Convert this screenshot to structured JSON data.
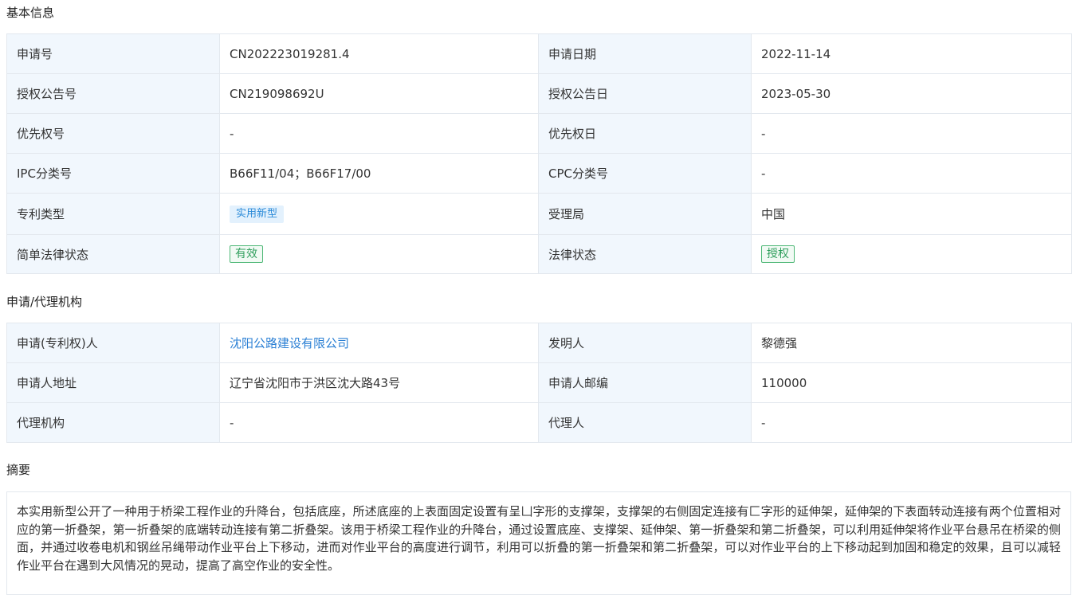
{
  "basic_info": {
    "title": "基本信息",
    "rows": [
      {
        "label1": "申请号",
        "value1": "CN202223019281.4",
        "label2": "申请日期",
        "value2": "2022-11-14"
      },
      {
        "label1": "授权公告号",
        "value1": "CN219098692U",
        "label2": "授权公告日",
        "value2": "2023-05-30"
      },
      {
        "label1": "优先权号",
        "value1": "-",
        "label2": "优先权日",
        "value2": "-"
      },
      {
        "label1": "IPC分类号",
        "value1": "B66F11/04；B66F17/00",
        "label2": "CPC分类号",
        "value2": "-"
      },
      {
        "label1": "专利类型",
        "value1": "实用新型",
        "label2": "受理局",
        "value2": "中国"
      },
      {
        "label1": "简单法律状态",
        "value1": "有效",
        "label2": "法律状态",
        "value2": "授权"
      }
    ]
  },
  "agency_info": {
    "title": "申请/代理机构",
    "rows": [
      {
        "label1": "申请(专利权)人",
        "value1": "沈阳公路建设有限公司",
        "label2": "发明人",
        "value2": "黎德强"
      },
      {
        "label1": "申请人地址",
        "value1": "辽宁省沈阳市于洪区沈大路43号",
        "label2": "申请人邮编",
        "value2": "110000"
      },
      {
        "label1": "代理机构",
        "value1": "-",
        "label2": "代理人",
        "value2": "-"
      }
    ]
  },
  "abstract": {
    "title": "摘要",
    "text": "本实用新型公开了一种用于桥梁工程作业的升降台，包括底座，所述底座的上表面固定设置有呈凵字形的支撑架，支撑架的右侧固定连接有匚字形的延伸架，延伸架的下表面转动连接有两个位置相对应的第一折叠架，第一折叠架的底端转动连接有第二折叠架。该用于桥梁工程作业的升降台，通过设置底座、支撑架、延伸架、第一折叠架和第二折叠架，可以利用延伸架将作业平台悬吊在桥梁的侧面，并通过收卷电机和钢丝吊绳带动作业平台上下移动，进而对作业平台的高度进行调节，利用可以折叠的第一折叠架和第二折叠架，可以对作业平台的上下移动起到加固和稳定的效果，且可以减轻作业平台在遇到大风情况的晃动，提高了高空作业的安全性。"
  },
  "colors": {
    "label_bg": "#f1f7fd",
    "border": "#e3e8ee",
    "link": "#2a7fd4",
    "tag_blue_bg": "#e3f1fd",
    "tag_blue_text": "#2a8ad8",
    "tag_green": "#2f9e5c"
  }
}
